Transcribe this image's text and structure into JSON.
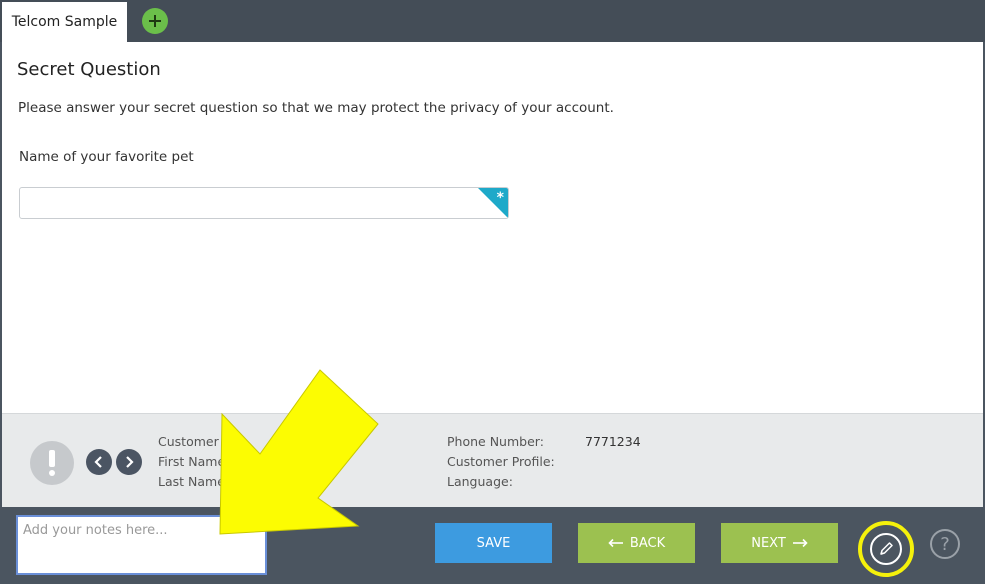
{
  "tabs": [
    {
      "label": "Telcom Sample"
    }
  ],
  "add_tab_icon": "plus-icon",
  "page": {
    "title": "Secret Question",
    "description": "Please answer your secret question so that we may protect the privacy of your account.",
    "field_label": "Name of your favorite pet",
    "field_value": "",
    "required_marker": "*"
  },
  "customer_info": {
    "left_labels": [
      "Customer",
      "First Name",
      "Last Name"
    ],
    "right_labels": [
      "Phone Number:",
      "Customer Profile:",
      "Language:"
    ],
    "phone_number": "7771234",
    "customer_profile": "",
    "language": ""
  },
  "toolbar": {
    "notes_placeholder": "Add your notes here...",
    "save_label": "SAVE",
    "back_label": "BACK",
    "next_label": "NEXT",
    "help_symbol": "?"
  },
  "colors": {
    "tabbar": "#444d57",
    "add_tab": "#6bbf4a",
    "required": "#1ea9c9",
    "save": "#3d9be0",
    "back_next": "#9cc150",
    "toolbar": "#4b5560",
    "highlight": "#f5f10b",
    "annotation_arrow": "#fcfc02"
  }
}
